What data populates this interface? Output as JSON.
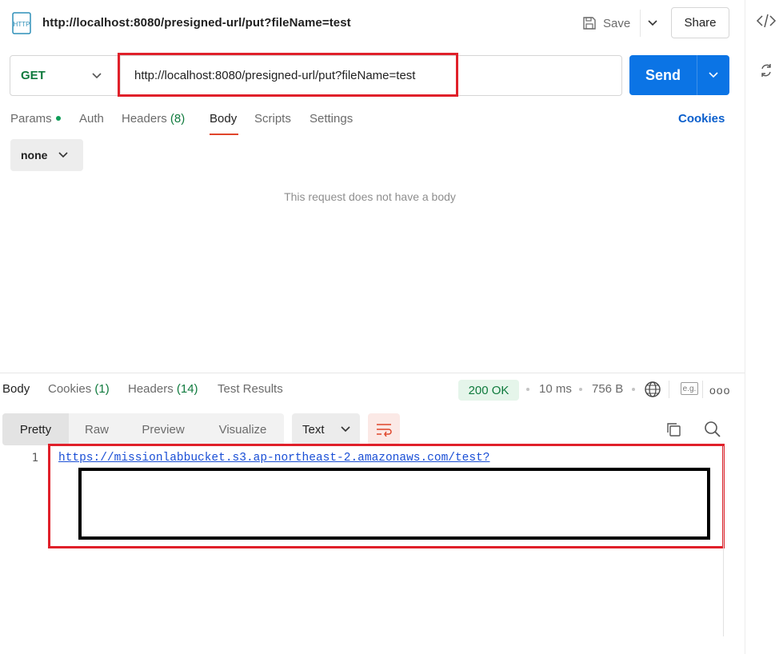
{
  "header": {
    "title": "http://localhost:8080/presigned-url/put?fileName=test",
    "icon": "http-request-icon",
    "save_label": "Save",
    "share_label": "Share"
  },
  "request": {
    "method": "GET",
    "url": "http://localhost:8080/presigned-url/put?fileName=test",
    "send_label": "Send",
    "tabs": [
      {
        "label": "Params",
        "has_dot": true
      },
      {
        "label": "Auth"
      },
      {
        "label": "Headers",
        "count": "(8)"
      },
      {
        "label": "Body",
        "active": true
      },
      {
        "label": "Scripts"
      },
      {
        "label": "Settings"
      }
    ],
    "cookies_label": "Cookies",
    "body_type": "none",
    "empty_body_message": "This request does not have a body"
  },
  "response": {
    "tabs": [
      {
        "label": "Body",
        "active": true
      },
      {
        "label": "Cookies",
        "count": "(1)"
      },
      {
        "label": "Headers",
        "count": "(14)"
      },
      {
        "label": "Test Results"
      }
    ],
    "status": "200 OK",
    "time": "10 ms",
    "size": "756 B",
    "example_label": "e.g.",
    "more_label": "ooo",
    "view_options": [
      "Pretty",
      "Raw",
      "Preview",
      "Visualize"
    ],
    "active_view": "Pretty",
    "format": "Text",
    "lines": [
      {
        "number": "1",
        "text": "https://missionlabbucket.s3.ap-northeast-2.amazonaws.com/test?"
      }
    ]
  },
  "colors": {
    "accent_send": "#0b74e5",
    "method_get": "#0f7a3d",
    "status_ok_bg": "#e5f5ea",
    "highlight_red": "#e0202a",
    "tab_underline": "#e0452a",
    "link": "#1a4fd6"
  }
}
